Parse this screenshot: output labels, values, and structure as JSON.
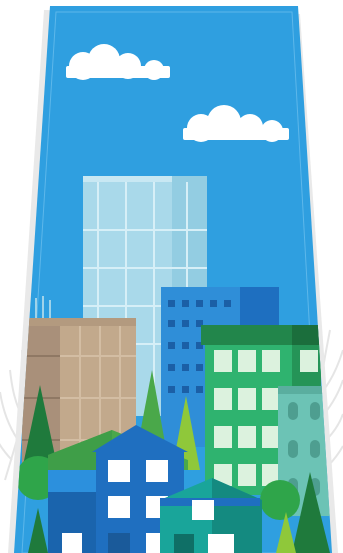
{
  "scene": {
    "name": "city-skyline-illustration",
    "colors": {
      "background": "#ffffff",
      "frame_shadow": "#e9e9e9",
      "sky": "#2f9fe0",
      "cloud": "#ffffff",
      "glass_tower": "#a9d9ea",
      "tan_building": "#c2a98c",
      "blue_office": "#2f8ed8",
      "green_building": "#2fb36f",
      "teal_building": "#6cc3b5",
      "tree_dark": "#1f7a3c",
      "tree_light": "#8fc83a",
      "house_blue": "#1f6fc0",
      "house_teal": "#19a59a"
    },
    "elements": [
      "cloud-left",
      "cloud-right",
      "glass-tower",
      "tan-building",
      "blue-office-building",
      "green-apartment-building",
      "teal-building",
      "tree",
      "blue-house",
      "teal-house",
      "leaf-decoration"
    ]
  }
}
